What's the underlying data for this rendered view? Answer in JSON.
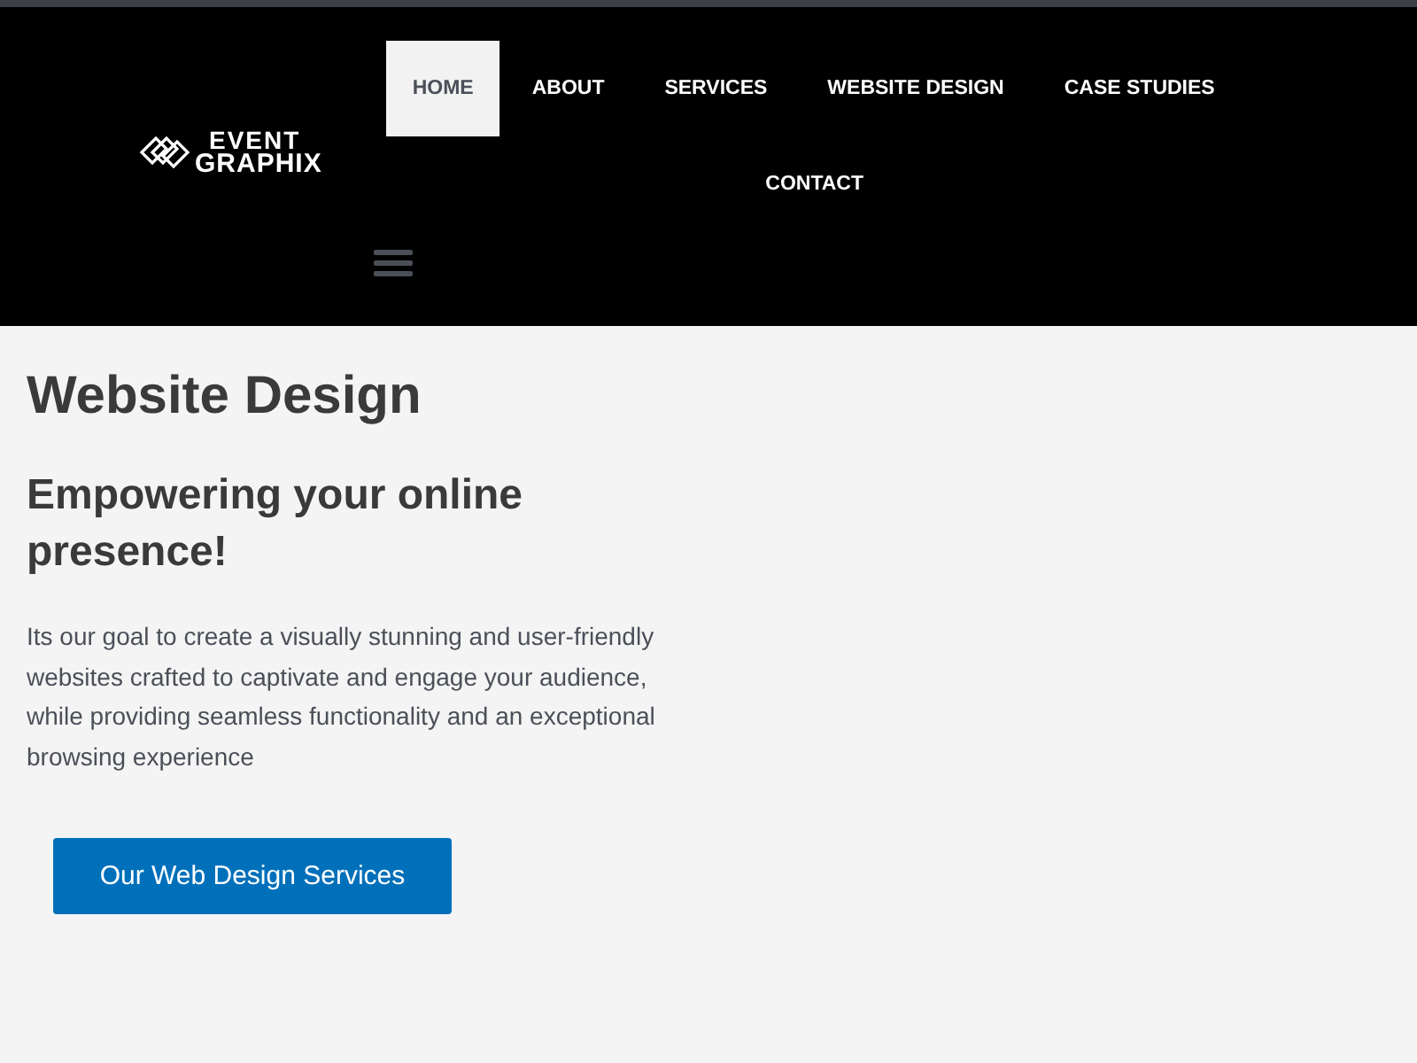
{
  "logo": {
    "line_1": "EVENT",
    "line_2": "GRAPHIX"
  },
  "nav": [
    {
      "label": "HOME",
      "selected": true
    },
    {
      "label": "ABOUT",
      "selected": false
    },
    {
      "label": "SERVICES",
      "selected": false
    },
    {
      "label": "WEBSITE DESIGN",
      "selected": false
    },
    {
      "label": "CASE STUDIES",
      "selected": false
    },
    {
      "label": "CONTACT",
      "selected": false
    }
  ],
  "page_title": "Website Design",
  "subtitle": "Empowering your online presence!",
  "description": "Its our goal to create a visually stunning and user-friendly websites crafted to captivate and engage your audience, while providing seamless functionality and an exceptional browsing experience",
  "cta_button": "Our Web Design Services"
}
